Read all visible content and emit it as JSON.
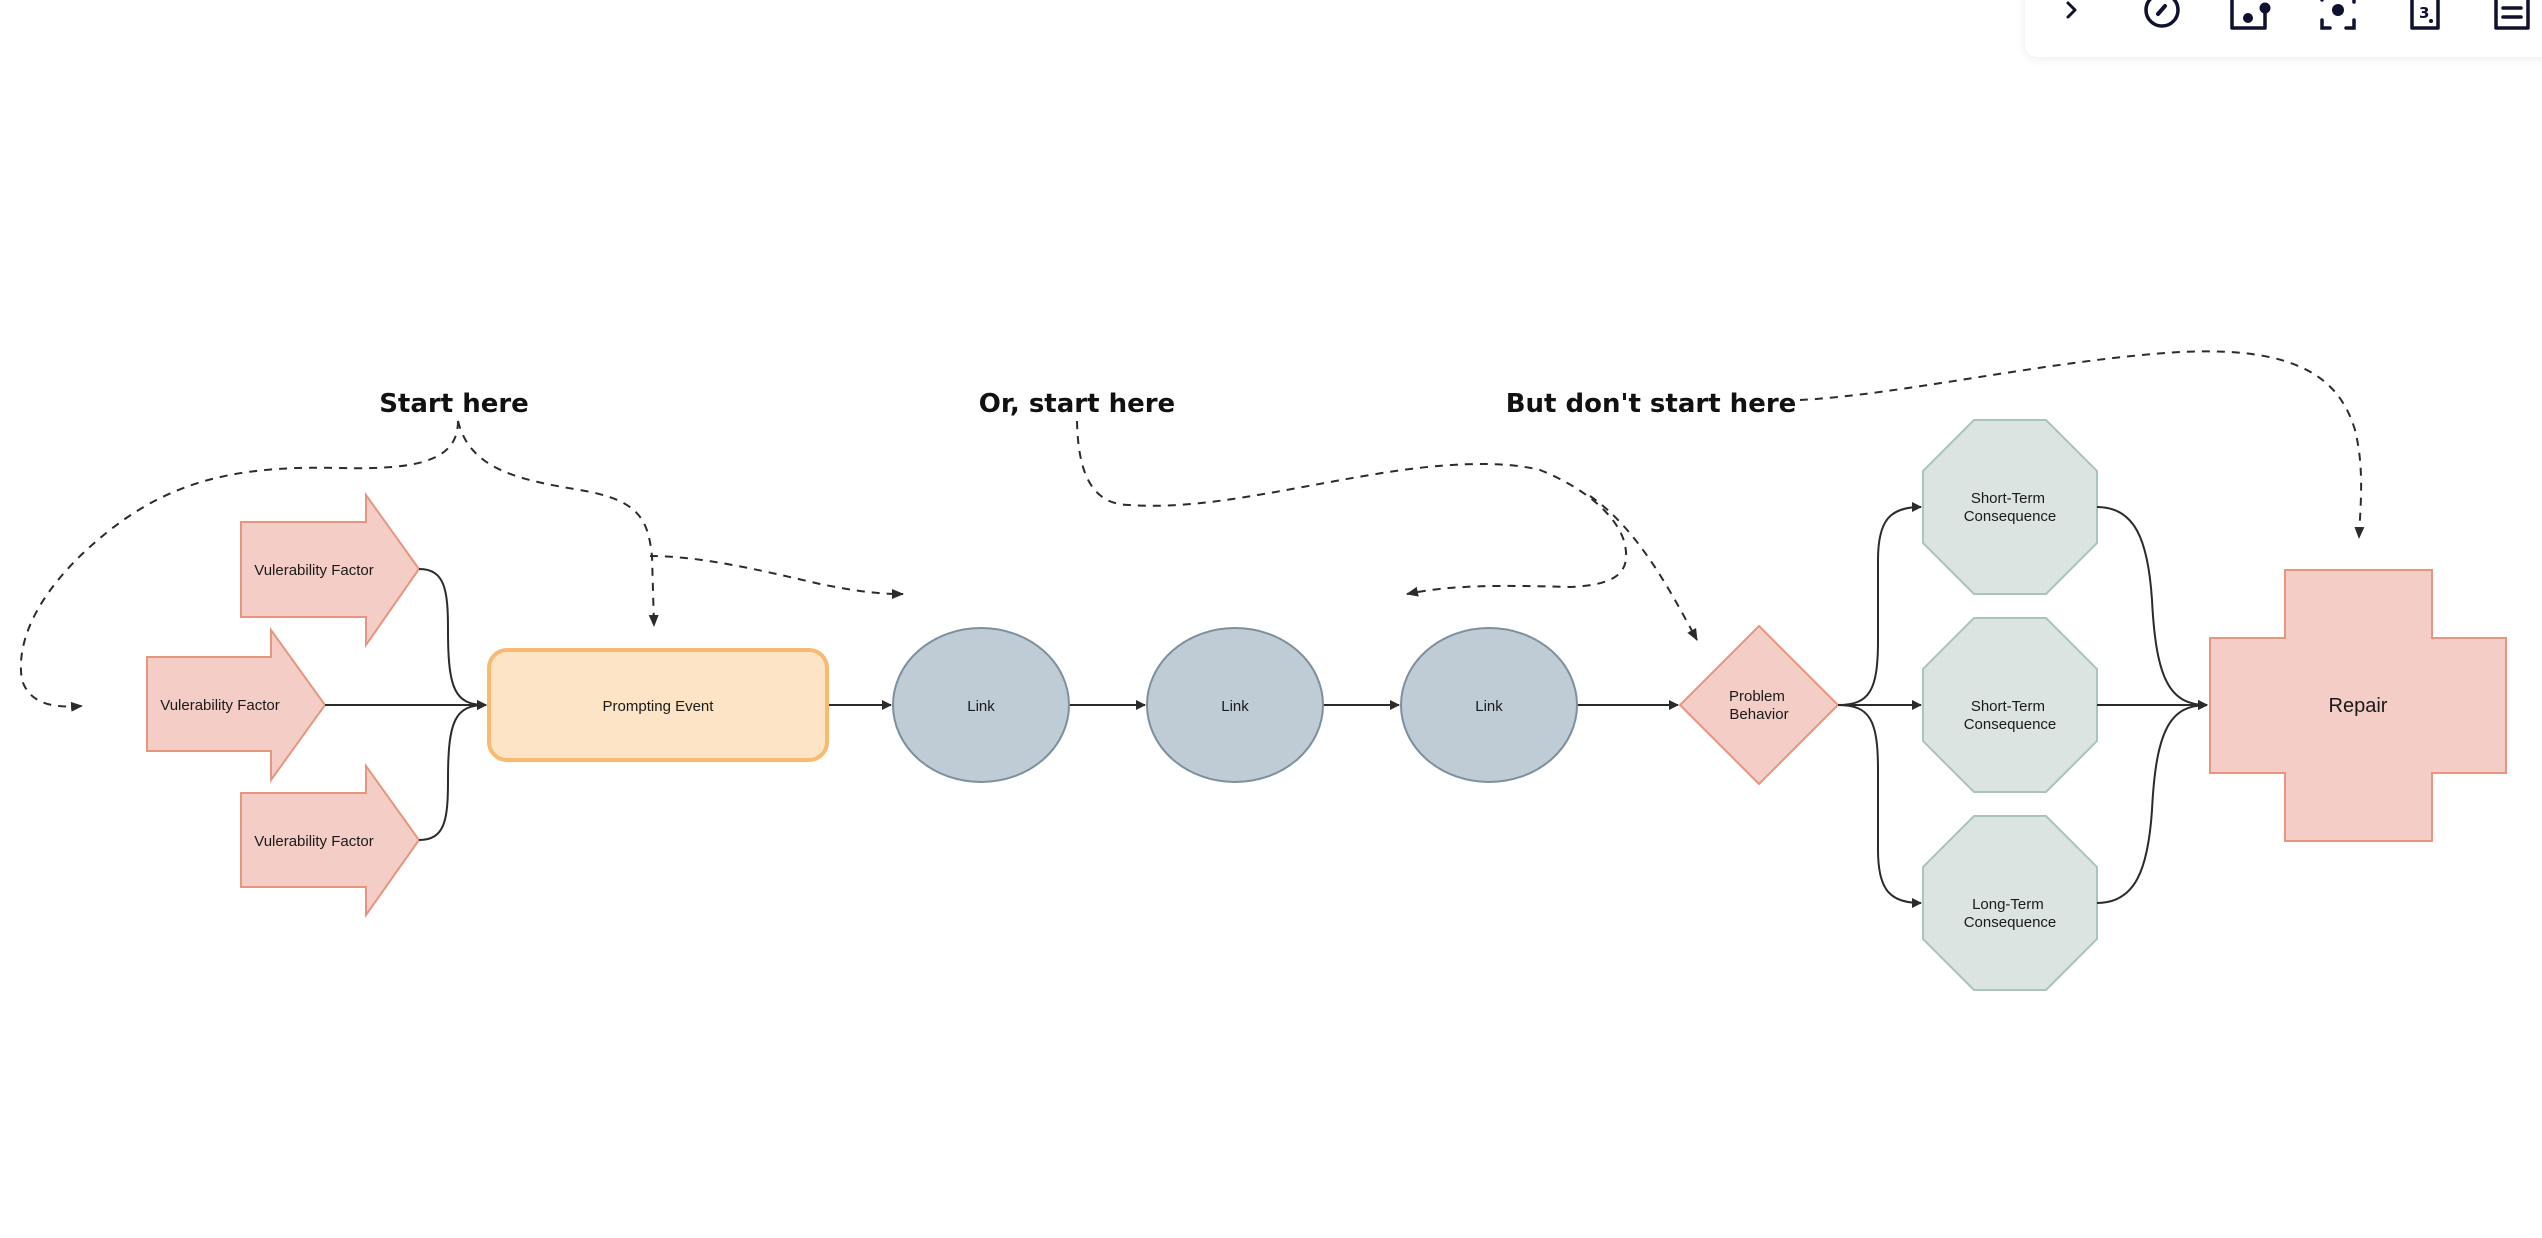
{
  "toolbar": {
    "items": [
      {
        "icon": "chevron-right-icon",
        "label": "Collapse"
      },
      {
        "icon": "gauge-icon",
        "label": "Presentation"
      },
      {
        "icon": "frame-icon",
        "label": "Frame"
      },
      {
        "icon": "focus-icon",
        "label": "Focus"
      },
      {
        "icon": "numbered-page-icon",
        "label": "Page numbers"
      },
      {
        "icon": "notes-icon",
        "label": "Notes"
      }
    ]
  },
  "annotations": {
    "start_here": "Start here",
    "or_start_here": "Or, start here",
    "dont_start_here": "But don't start here"
  },
  "nodes": {
    "vulnerability_1": "Vulerability Factor",
    "vulnerability_2": "Vulerability Factor",
    "vulnerability_3": "Vulerability Factor",
    "prompting_event": "Prompting Event",
    "link_1": "Link",
    "link_2": "Link",
    "link_3": "Link",
    "problem_behavior": [
      "Problem",
      "Behavior"
    ],
    "consequence_1": [
      "Short-Term",
      "Consequence"
    ],
    "consequence_2": [
      "Short-Term",
      "Consequence"
    ],
    "consequence_3": [
      "Long-Term",
      "Consequence"
    ],
    "repair": "Repair"
  },
  "colors": {
    "vulnerability_fill": "#f4cdc6",
    "vulnerability_stroke": "#e6957f",
    "prompting_fill": "#fde4c6",
    "prompting_stroke": "#f8b970",
    "link_fill": "#bfccd6",
    "link_stroke": "#7d909e",
    "consequence_fill": "#dbe4e0",
    "consequence_stroke": "#a9c4b8",
    "connector": "#2b2b2b",
    "icon": "#0f1130"
  }
}
